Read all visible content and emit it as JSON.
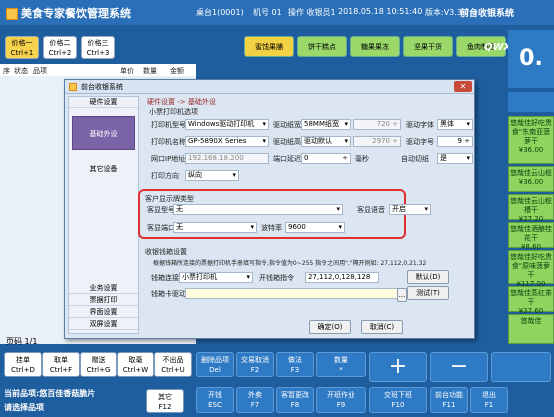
{
  "app": {
    "title": "美食专家餐饮管理系统",
    "table": "桌台1(0001)",
    "machine": "机号 01",
    "operator": "操作 收银员1",
    "datetime": "2018.05.18 10:51:40",
    "version": "版本:V3.3.7.3",
    "mode": "前台收银系统"
  },
  "price_buttons": [
    {
      "label": "价格一",
      "key": "Ctrl+1"
    },
    {
      "label": "价格二",
      "key": "Ctrl+2"
    },
    {
      "label": "价格三",
      "key": "Ctrl+3"
    }
  ],
  "categories": [
    "蜜饯果脯",
    "饼干糕点",
    "糖果果冻",
    "坚果干货",
    "鱼肉制品"
  ],
  "qwx": "QWX",
  "order_columns": [
    "序",
    "状态",
    "品项",
    "单价",
    "数量",
    "金额"
  ],
  "page_count": "页码 1/1",
  "big_display": "0.",
  "dishes": [
    {
      "name": "悠哉佳好吃贵食\"东南亚菠萝干",
      "price": "¥36.00"
    },
    {
      "name": "悠哉佳云山榄",
      "price": "¥36.00"
    },
    {
      "name": "悠哉佳云山榄槽干",
      "price": "¥27.20"
    },
    {
      "name": "悠哉佳酒酿桂花干",
      "price": "¥8.60"
    },
    {
      "name": "悠哉佳好吃贵食\"原味菠萝干",
      "price": "¥117.00"
    },
    {
      "name": "悠哉佳蒸红茶干",
      "price": "¥37.60"
    },
    {
      "name": "悠哉佳",
      "price": ""
    }
  ],
  "bottom_buttons": [
    {
      "label": "挂单",
      "key": "Ctrl+D"
    },
    {
      "label": "取单",
      "key": "Ctrl+F"
    },
    {
      "label": "赠送",
      "key": "Ctrl+G"
    },
    {
      "label": "取毫",
      "key": "Ctrl+W"
    },
    {
      "label": "不出品",
      "key": "Ctrl+U"
    },
    {
      "label": "其它",
      "key": "F12"
    }
  ],
  "fn_buttons_row1": [
    {
      "label": "删除品项",
      "key": "Del"
    },
    {
      "label": "交易取消",
      "key": "F2"
    },
    {
      "label": "做法",
      "key": "F3"
    },
    {
      "label": "数量",
      "key": "*"
    }
  ],
  "fn_buttons_row2": [
    {
      "label": "开钱",
      "key": "ESC"
    },
    {
      "label": "外卖",
      "key": "F7"
    },
    {
      "label": "客暂更改",
      "key": "F8"
    },
    {
      "label": "开班作业",
      "key": "F9"
    },
    {
      "label": "交班下班",
      "key": "F10"
    },
    {
      "label": "前台功能",
      "key": "F11"
    },
    {
      "label": "退出",
      "key": "F1"
    }
  ],
  "plus_label": "+",
  "minus_label": "−",
  "status": {
    "current_item": "当前品项:悠百佳香菇脆片",
    "hint": "请选择品项"
  },
  "dialog": {
    "title": "前台收银系统",
    "close": "✕",
    "sidebar_top": "硬件设置",
    "sidebar_active": "基础外设",
    "sidebar_other": "其它设备",
    "sidebar_bottom": [
      "业务设置",
      "票据打印",
      "界面设置",
      "双屏设置"
    ],
    "breadcrumb": "硬件设置 -> 基础外设",
    "printer_section": "小票打印机选项",
    "printer_type_label": "打印机型号",
    "printer_type_value": "Windows驱动打印机",
    "paper_width_label": "驱动纸宽",
    "paper_width_value": "58MM纸宽",
    "paper_width_num": "720",
    "font_label": "驱动字体",
    "font_value": "黑体",
    "printer_name_label": "打印机名称",
    "printer_name_value": "GP-5890X Series",
    "paper_height_label": "驱动纸高",
    "paper_height_value": "驱动默认",
    "paper_height_num": "2970",
    "font_size_label": "驱动字号",
    "font_size_value": "9",
    "ip_label": "网口IP地址",
    "ip_value": "192.168.18.200",
    "port_delay_label": "端口延迟",
    "port_delay_value": "0",
    "ms_label": "毫秒",
    "auto_cut_label": "自动切纸",
    "auto_cut_value": "是",
    "direction_label": "打印方向",
    "direction_value": "纵向",
    "customer_section": "客户显示牌类型",
    "customer_model_label": "客显型号",
    "customer_model_value": "无",
    "customer_voice_label": "客显语音",
    "customer_voice_value": "开启",
    "customer_port_label": "客显端口",
    "customer_port_value": "无",
    "baud_label": "波特率",
    "baud_value": "9600",
    "cash_section": "收银钱箱设置",
    "cash_note": "根据钱箱所连接的票据打印机手册填写指令,指令值为0~255 指令之间用\",\"隔开例如: 27,112,0,21,32",
    "cash_conn_label": "钱箱连接",
    "cash_conn_value": "小票打印机",
    "cash_cmd_label": "开钱箱指令",
    "cash_cmd_value": "27,112,0,128,128",
    "cash_default": "默认(D)",
    "cash_card_label": "钱箱卡驱动",
    "cash_card_value": "",
    "cash_browse": "...",
    "cash_test": "测试(T)",
    "ok": "确定(O)",
    "cancel": "取消(C)"
  }
}
